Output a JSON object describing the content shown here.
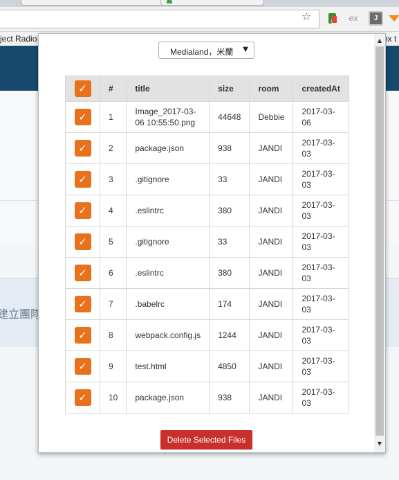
{
  "browser": {
    "bookmarks": [
      {
        "label": "ject Radio"
      },
      {
        "label": "ex t"
      }
    ],
    "extensions": [
      {
        "icon": "evernote-web-clipper-icon"
      },
      {
        "label": "ex"
      },
      {
        "label": "J"
      },
      {
        "icon": "orange-extension-icon"
      }
    ]
  },
  "page": {
    "background_text": "建立團隊"
  },
  "popup": {
    "team_select": {
      "selected": "Medialand，米蘭"
    },
    "table": {
      "headers": [
        "#",
        "title",
        "size",
        "room",
        "createdAt"
      ],
      "rows": [
        {
          "num": "1",
          "title": "Image_2017-03-06 10:55:50.png",
          "size": "44648",
          "room": "Debbie",
          "createdAt": "2017-03-06"
        },
        {
          "num": "2",
          "title": "package.json",
          "size": "938",
          "room": "JANDI",
          "createdAt": "2017-03-03"
        },
        {
          "num": "3",
          "title": ".gitignore",
          "size": "33",
          "room": "JANDI",
          "createdAt": "2017-03-03"
        },
        {
          "num": "4",
          "title": ".eslintrc",
          "size": "380",
          "room": "JANDI",
          "createdAt": "2017-03-03"
        },
        {
          "num": "5",
          "title": ".gitignore",
          "size": "33",
          "room": "JANDI",
          "createdAt": "2017-03-03"
        },
        {
          "num": "6",
          "title": ".eslintrc",
          "size": "380",
          "room": "JANDI",
          "createdAt": "2017-03-03"
        },
        {
          "num": "7",
          "title": ".babelrc",
          "size": "174",
          "room": "JANDI",
          "createdAt": "2017-03-03"
        },
        {
          "num": "8",
          "title": "webpack.config.js",
          "size": "1244",
          "room": "JANDI",
          "createdAt": "2017-03-03"
        },
        {
          "num": "9",
          "title": "test.html",
          "size": "4850",
          "room": "JANDI",
          "createdAt": "2017-03-03"
        },
        {
          "num": "10",
          "title": "package.json",
          "size": "938",
          "room": "JANDI",
          "createdAt": "2017-03-03"
        }
      ]
    },
    "delete_button": "Delete Selected Files"
  },
  "colors": {
    "checkbox": "#e8711c",
    "delete_button": "#c9302c",
    "page_header": "#17496d"
  }
}
